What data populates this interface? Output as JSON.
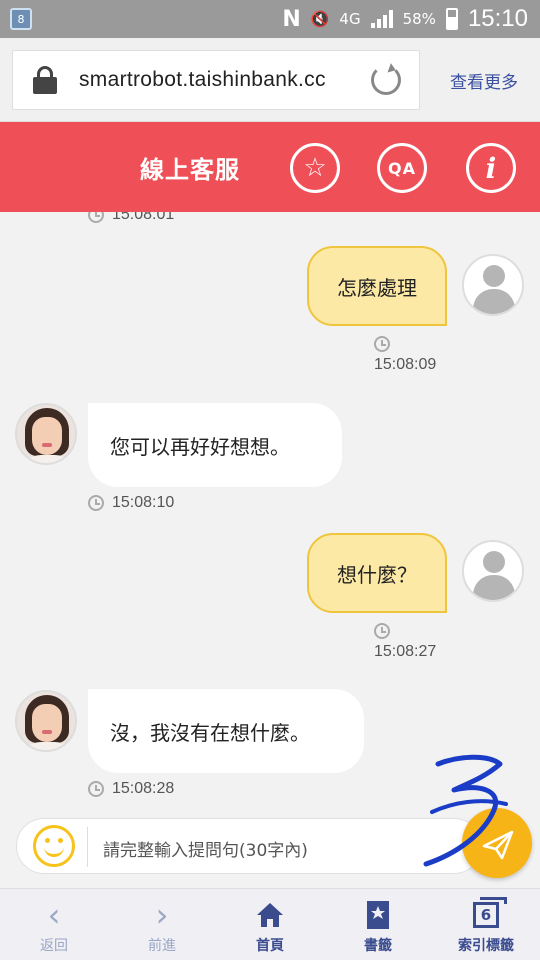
{
  "status_bar": {
    "notification_badge": "8",
    "network": "4G",
    "battery": "58%",
    "time": "15:10"
  },
  "browser": {
    "url": "smartrobot.taishinbank.cc",
    "more_link": "查看更多"
  },
  "header": {
    "title": "線上客服",
    "qa_label": "QA",
    "info_label": "i",
    "bg_color": "#ef4f57"
  },
  "chat": {
    "messages": [
      {
        "from": "bot",
        "time": "15:08:01"
      },
      {
        "from": "user",
        "text": "怎麼處理",
        "time": "15:08:09"
      },
      {
        "from": "bot",
        "text": "您可以再好好想想。",
        "time": "15:08:10"
      },
      {
        "from": "user",
        "text": "想什麼？",
        "time": "15:08:27"
      },
      {
        "from": "bot",
        "text": "沒，我沒有在想什麼。",
        "time": "15:08:28"
      }
    ]
  },
  "input": {
    "placeholder": "請完整輸入提問句(30字內)"
  },
  "annotation": "3",
  "bottom_nav": {
    "items": [
      {
        "label": "返回",
        "icon": "chevron-left-icon",
        "enabled": false
      },
      {
        "label": "前進",
        "icon": "chevron-right-icon",
        "enabled": false
      },
      {
        "label": "首頁",
        "icon": "home-icon",
        "enabled": true
      },
      {
        "label": "書籤",
        "icon": "bookmark-icon",
        "enabled": true
      },
      {
        "label": "索引標籤",
        "icon": "tabs-icon",
        "enabled": true,
        "count": "6"
      }
    ]
  },
  "colors": {
    "user_bubble": "#fde9a6",
    "user_bubble_border": "#efc53e",
    "bot_bubble": "#ffffff",
    "send_button": "#f6b417",
    "nav_active": "#3a4c8e"
  }
}
